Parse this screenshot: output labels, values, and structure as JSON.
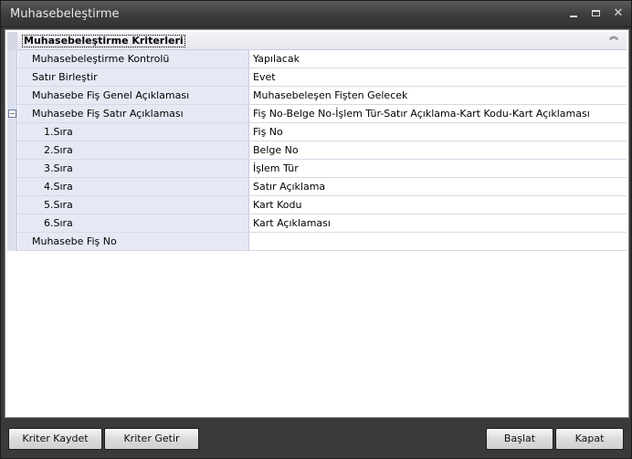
{
  "window": {
    "title": "Muhasebeleştirme"
  },
  "category": {
    "title": "Muhasebeleştirme Kriterleri",
    "collapse_glyph": "︽"
  },
  "properties": [
    {
      "label": "Muhasebeleştirme Kontrolü",
      "value": "Yapılacak"
    },
    {
      "label": "Satır Birleştir",
      "value": "Evet"
    },
    {
      "label": "Muhasebe Fiş Genel Açıklaması",
      "value": "Muhasebeleşen Fişten Gelecek"
    },
    {
      "label": "Muhasebe Fiş Satır Açıklaması",
      "value": "Fiş No-Belge No-İşlem Tür-Satır Açıklama-Kart Kodu-Kart Açıklaması",
      "expander": "−"
    },
    {
      "label": "1.Sıra",
      "value": "Fiş No"
    },
    {
      "label": "2.Sıra",
      "value": "Belge No"
    },
    {
      "label": "3.Sıra",
      "value": "İşlem Tür"
    },
    {
      "label": "4.Sıra",
      "value": "Satır Açıklama"
    },
    {
      "label": "5.Sıra",
      "value": "Kart Kodu"
    },
    {
      "label": "6.Sıra",
      "value": "Kart Açıklaması"
    },
    {
      "label": "Muhasebe Fiş No",
      "value": ""
    }
  ],
  "buttons": {
    "save_criteria": "Kriter Kaydet",
    "load_criteria": "Kriter Getir",
    "start": "Başlat",
    "close": "Kapat"
  }
}
